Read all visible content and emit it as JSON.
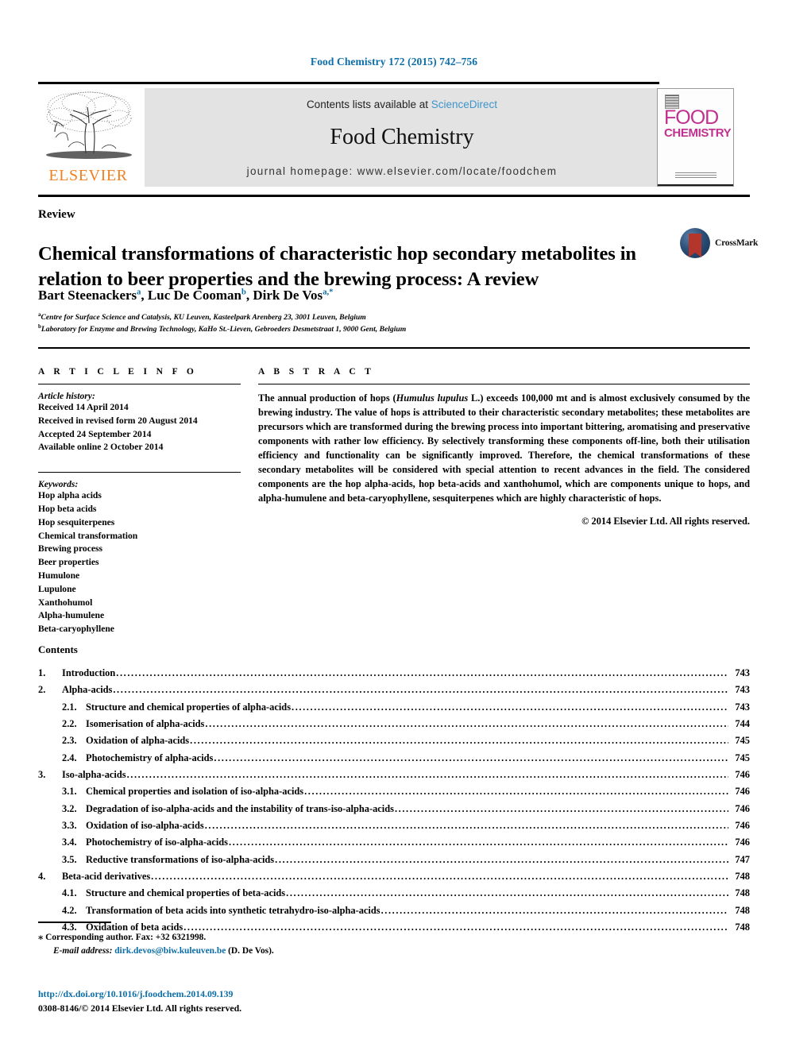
{
  "running_head": "Food Chemistry 172 (2015) 742–756",
  "masthead": {
    "contents_lists_prefix": "Contents lists available at ",
    "sciencedirect": "ScienceDirect",
    "journal_title": "Food Chemistry",
    "homepage": "journal homepage: www.elsevier.com/locate/foodchem",
    "publisher_logo_text": "ELSEVIER",
    "cover_word_top": "FOOD",
    "cover_word_bottom": "CHEMISTRY",
    "accent_blue": "#0b6ea8",
    "link_blue": "#3e94cc",
    "elsevier_orange": "#f08121",
    "cover_magenta": "#c0308f",
    "banner_grey": "#e3e3e3"
  },
  "article": {
    "doctype": "Review",
    "title": "Chemical transformations of characteristic hop secondary metabolites in relation to beer properties and the brewing process: A review",
    "authors": [
      {
        "name": "Bart Steenackers",
        "sup": "a",
        "sep": ", "
      },
      {
        "name": "Luc De Cooman",
        "sup": "b",
        "sep": ", "
      },
      {
        "name": "Dirk De Vos",
        "sup": "a,*",
        "sep": ""
      }
    ],
    "affiliations": [
      {
        "mark": "a",
        "text": "Centre for Surface Science and Catalysis, KU Leuven, Kasteelpark Arenberg 23, 3001 Leuven, Belgium"
      },
      {
        "mark": "b",
        "text": "Laboratory for Enzyme and Brewing Technology, KaHo St.-Lieven, Gebroeders Desmetstraat 1, 9000 Gent, Belgium"
      }
    ],
    "crossmark_label": "CrossMark"
  },
  "article_info": {
    "heading": "A R T I C L E  I N F O",
    "history_title": "Article history:",
    "history": [
      "Received 14 April 2014",
      "Received in revised form 20 August 2014",
      "Accepted 24 September 2014",
      "Available online 2 October 2014"
    ],
    "keywords_title": "Keywords:",
    "keywords": [
      "Hop alpha acids",
      "Hop beta acids",
      "Hop sesquiterpenes",
      "Chemical transformation",
      "Brewing process",
      "Beer properties",
      "Humulone",
      "Lupulone",
      "Xanthohumol",
      "Alpha-humulene",
      "Beta-caryophyllene"
    ]
  },
  "abstract": {
    "heading": "A B S T R A C T",
    "part1": "The annual production of hops (",
    "species": "Humulus lupulus",
    "part2": " L.) exceeds 100,000 mt and is almost exclusively consumed by the brewing industry. The value of hops is attributed to their characteristic secondary metabolites; these metabolites are precursors which are transformed during the brewing process into important bittering, aromatising and preservative components with rather low efficiency. By selectively transforming these components off-line, both their utilisation efficiency and functionality can be significantly improved. Therefore, the chemical transformations of these secondary metabolites will be considered with special attention to recent advances in the field. The considered components are the hop alpha-acids, hop beta-acids and xanthohumol, which are components unique to hops, and alpha-humulene and beta-caryophyllene, sesquiterpenes which are highly characteristic of hops.",
    "copyright": "© 2014 Elsevier Ltd. All rights reserved."
  },
  "contents": {
    "heading": "Contents",
    "items": [
      {
        "level": 1,
        "num": "1.",
        "label": "Introduction",
        "page": "743"
      },
      {
        "level": 1,
        "num": "2.",
        "label": "Alpha-acids",
        "page": "743"
      },
      {
        "level": 2,
        "num": "2.1.",
        "label": "Structure and chemical properties of alpha-acids",
        "page": "743"
      },
      {
        "level": 2,
        "num": "2.2.",
        "label": "Isomerisation of alpha-acids",
        "page": "744"
      },
      {
        "level": 2,
        "num": "2.3.",
        "label": "Oxidation of alpha-acids",
        "page": "745"
      },
      {
        "level": 2,
        "num": "2.4.",
        "label": "Photochemistry of alpha-acids",
        "page": "745"
      },
      {
        "level": 1,
        "num": "3.",
        "label": "Iso-alpha-acids",
        "page": "746"
      },
      {
        "level": 2,
        "num": "3.1.",
        "label": "Chemical properties and isolation of iso-alpha-acids",
        "page": "746"
      },
      {
        "level": 2,
        "num": "3.2.",
        "label": "Degradation of iso-alpha-acids and the instability of trans-iso-alpha-acids",
        "page": "746"
      },
      {
        "level": 2,
        "num": "3.3.",
        "label": "Oxidation of iso-alpha-acids",
        "page": "746"
      },
      {
        "level": 2,
        "num": "3.4.",
        "label": "Photochemistry of iso-alpha-acids",
        "page": "746"
      },
      {
        "level": 2,
        "num": "3.5.",
        "label": "Reductive transformations of iso-alpha-acids",
        "page": "747"
      },
      {
        "level": 1,
        "num": "4.",
        "label": "Beta-acid derivatives",
        "page": "748"
      },
      {
        "level": 2,
        "num": "4.1.",
        "label": "Structure and chemical properties of beta-acids",
        "page": "748"
      },
      {
        "level": 2,
        "num": "4.2.",
        "label": "Transformation of beta acids into synthetic tetrahydro-iso-alpha-acids",
        "page": "748"
      },
      {
        "level": 2,
        "num": "4.3.",
        "label": "Oxidation of beta acids",
        "page": "748"
      }
    ]
  },
  "footer": {
    "corresponding": "Corresponding author. Fax: +32 6321998.",
    "email_label": "E-mail address:",
    "email": "dirk.devos@biw.kuleuven.be",
    "email_owner": "(D. De Vos).",
    "doi": "http://dx.doi.org/10.1016/j.foodchem.2014.09.139",
    "issn_line": "0308-8146/© 2014 Elsevier Ltd. All rights reserved."
  }
}
